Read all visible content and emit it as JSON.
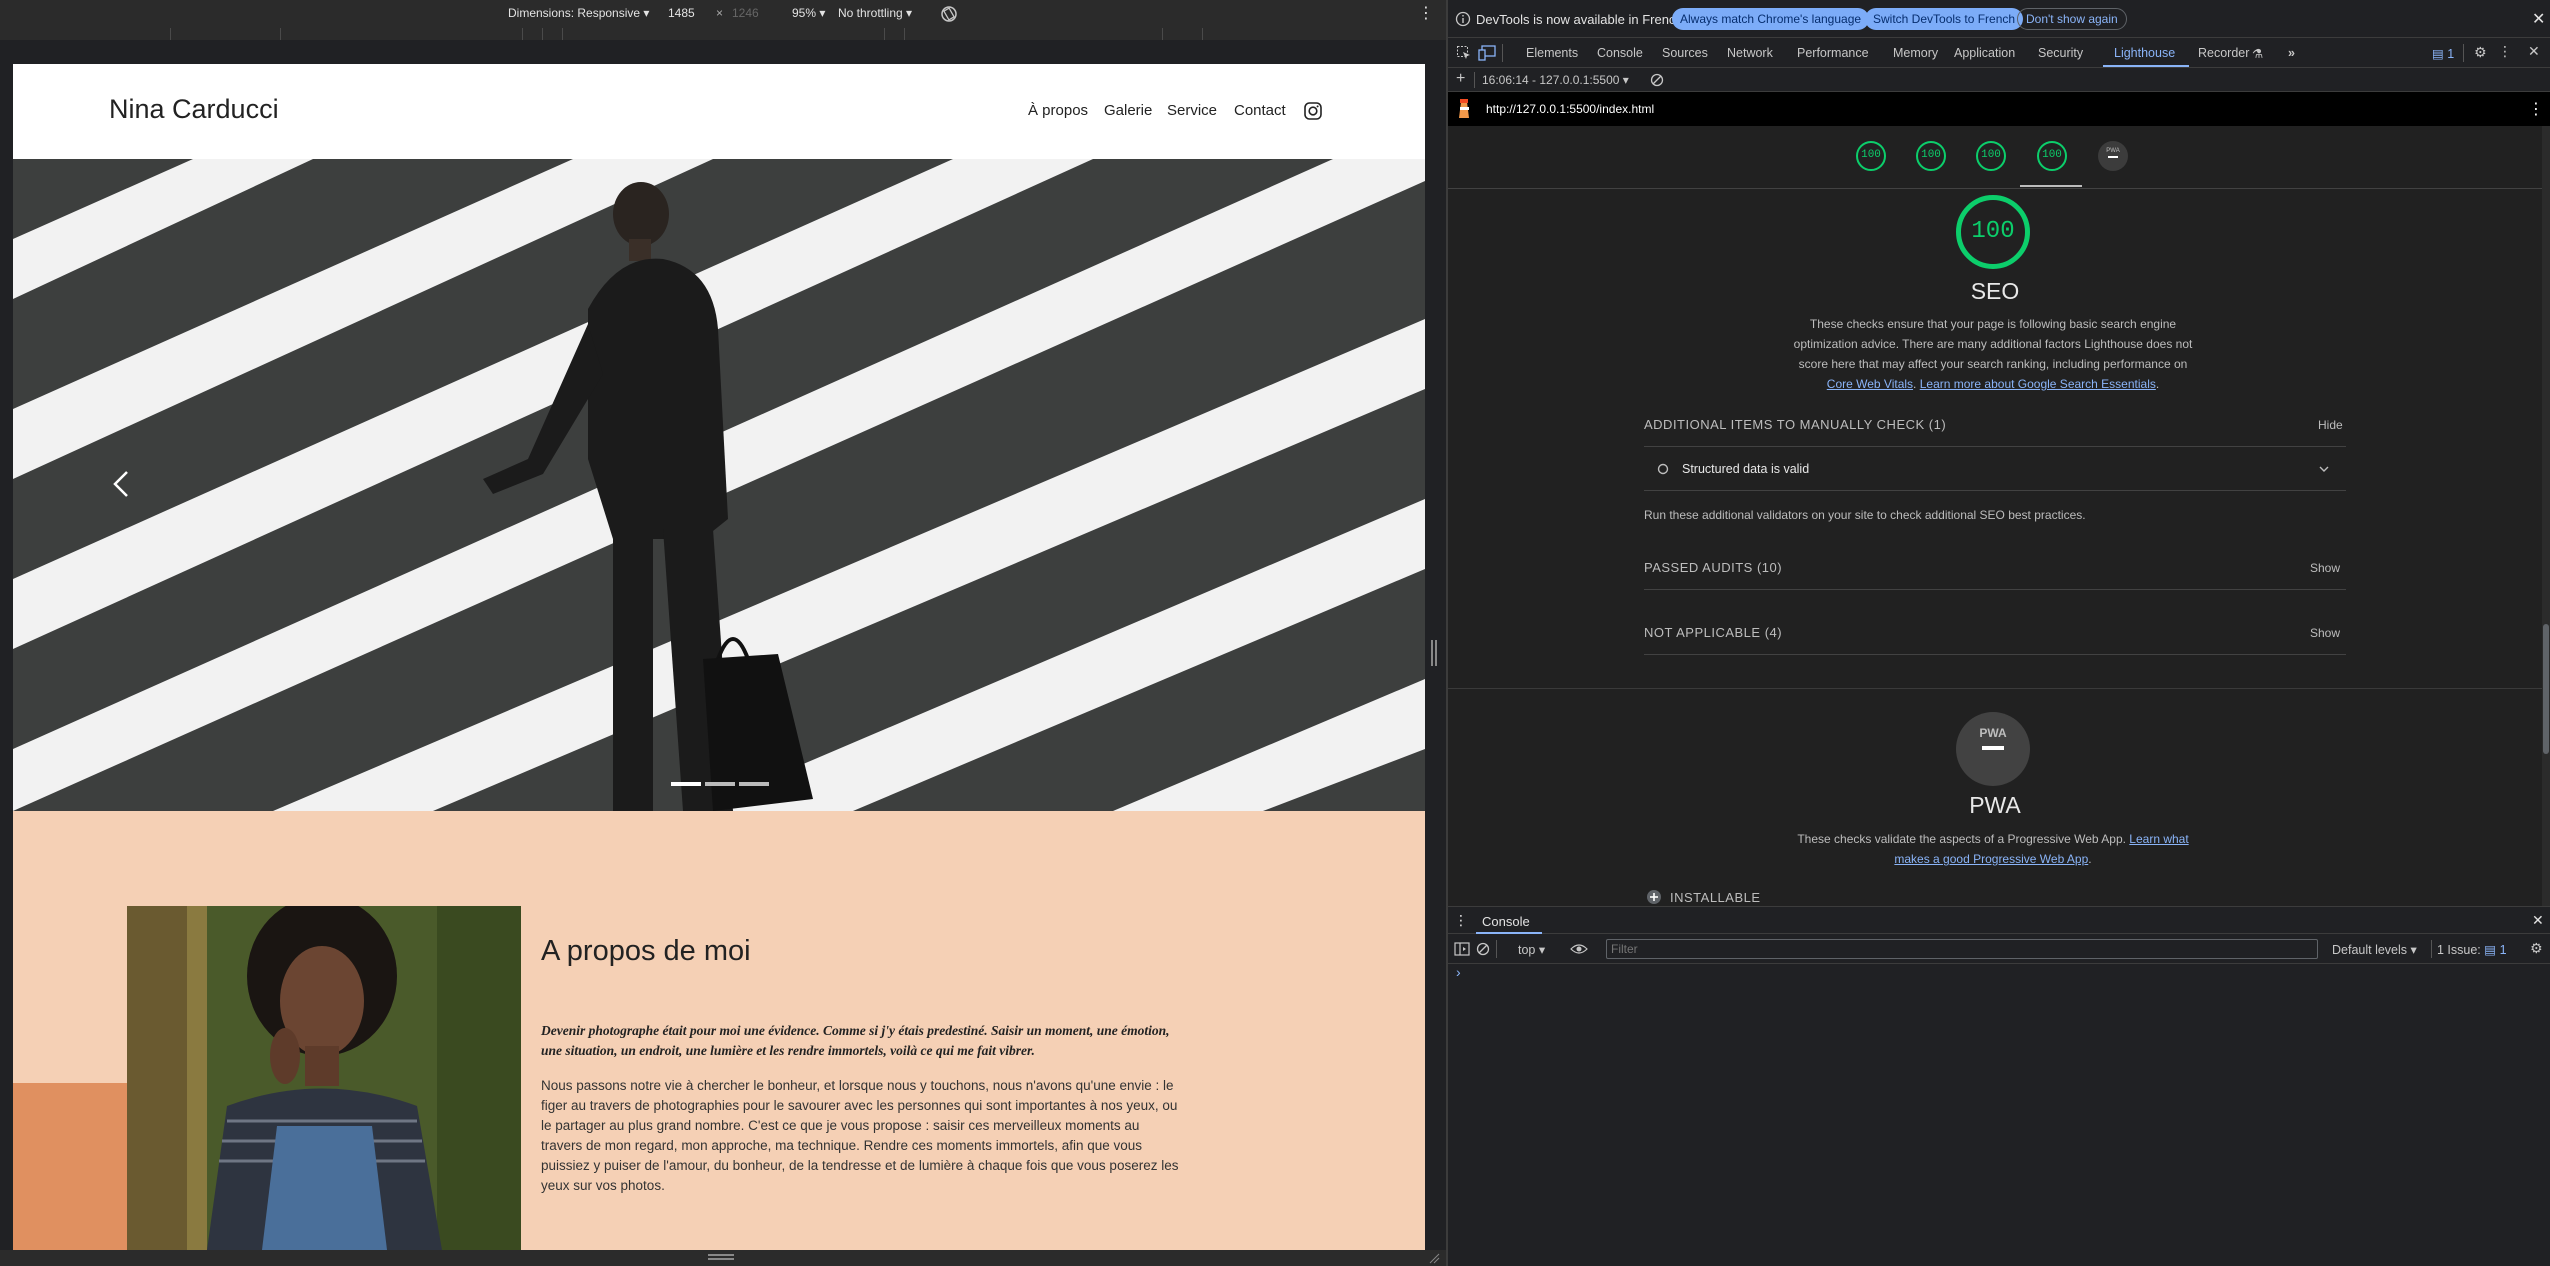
{
  "device_toolbar": {
    "dimensions_label": "Dimensions: Responsive",
    "width": "1485",
    "times": "×",
    "height": "1246",
    "zoom": "95%",
    "throttling": "No throttling"
  },
  "site": {
    "brand": "Nina Carducci",
    "nav": [
      "À propos",
      "Galerie",
      "Service",
      "Contact"
    ],
    "about_title": "A propos de moi",
    "about_quote": "Devenir photographe était pour moi une évidence. Comme si j'y étais predestiné. Saisir un moment, une émotion, une situation, un endroit, une lumière et les rendre immortels, voilà ce qui me fait vibrer.",
    "about_body": "Nous passons notre vie à chercher le bonheur, et lorsque nous y touchons, nous n'avons qu'une envie : le figer au travers de photographies pour le savourer avec les personnes qui sont importantes à nos yeux, ou le partager au plus grand nombre. C'est ce que je vous propose : saisir ces merveilleux moments au travers de mon regard, mon approche, ma technique. Rendre ces moments immortels, afin que vous puissiez y puiser de l'amour, du bonheur, de la tendresse et de lumière à chaque fois que vous poserez les yeux sur vos photos."
  },
  "devtools": {
    "infobar": {
      "message": "DevTools is now available in French!",
      "btn_match": "Always match Chrome's language",
      "btn_switch": "Switch DevTools to French",
      "btn_dismiss": "Don't show again"
    },
    "tabs": [
      "Elements",
      "Console",
      "Sources",
      "Network",
      "Performance",
      "Memory",
      "Application",
      "Security",
      "Lighthouse",
      "Recorder"
    ],
    "active_tab": "Lighthouse",
    "issues_badge": "1",
    "report_selector": "16:06:14 - 127.0.0.1:5500",
    "url": "http://127.0.0.1:5500/index.html",
    "scores": [
      "100",
      "100",
      "100",
      "100"
    ],
    "pwa_mini": "PWA",
    "seo": {
      "score": "100",
      "title": "SEO",
      "desc_1": "These checks ensure that your page is following basic search engine optimization advice. There are many additional factors Lighthouse does not score here that may affect your search ranking, including performance on",
      "link_cwv": "Core Web Vitals",
      "link_learn": "Learn more about Google Search Essentials",
      "manual_label": "ADDITIONAL ITEMS TO MANUALLY CHECK (1)",
      "manual_action": "Hide",
      "manual_item": "Structured data is valid",
      "manual_note": "Run these additional validators on your site to check additional SEO best practices.",
      "passed_label": "PASSED AUDITS (10)",
      "passed_action": "Show",
      "na_label": "NOT APPLICABLE (4)",
      "na_action": "Show"
    },
    "pwa": {
      "badge": "PWA",
      "title": "PWA",
      "desc": "These checks validate the aspects of a Progressive Web App.",
      "link": "Learn what makes a good Progressive Web App",
      "installable": "INSTALLABLE"
    },
    "console": {
      "tab": "Console",
      "context": "top",
      "filter_placeholder": "Filter",
      "levels": "Default levels",
      "issues": "1 Issue:",
      "issues_count": "1",
      "prompt": "›"
    }
  },
  "colors": {
    "accent_green": "#0cce6b",
    "about_bg": "#f5d0b5",
    "about_accent": "#e09060",
    "link": "#8ab4f8"
  }
}
